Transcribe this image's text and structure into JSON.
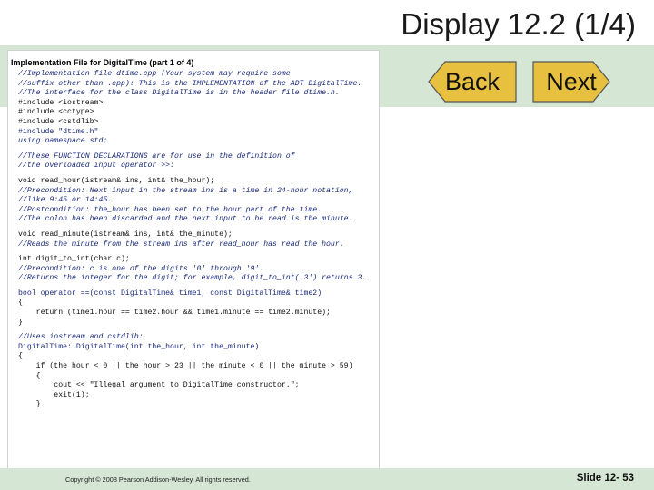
{
  "slide": {
    "title": "Display 12.2 (1/4)",
    "nav": {
      "back_label": "Back",
      "next_label": "Next"
    },
    "panel": {
      "header": "Implementation File for DigitalTime (part 1 of 4)",
      "lines": [
        {
          "text": "//Implementation file dtime.cpp (Your system may require some",
          "style": "comment"
        },
        {
          "text": "//suffix other than .cpp): This is the IMPLEMENTATION of the ADT DigitalTime.",
          "style": "comment"
        },
        {
          "text": "//The interface for the class DigitalTime is in the header file dtime.h.",
          "style": "comment"
        },
        {
          "text": "#include <iostream>",
          "style": "plain"
        },
        {
          "text": "#include <cctype>",
          "style": "plain"
        },
        {
          "text": "#include <cstdlib>",
          "style": "plain"
        },
        {
          "text": "#include \"dtime.h\"",
          "style": "kw"
        },
        {
          "text": "using namespace std;",
          "style": "comment"
        },
        {
          "text": "",
          "style": "gap"
        },
        {
          "text": "//These FUNCTION DECLARATIONS are for use in the definition of",
          "style": "comment"
        },
        {
          "text": "//the overloaded input operator >>:",
          "style": "comment"
        },
        {
          "text": "",
          "style": "gap"
        },
        {
          "text": "void read_hour(istream& ins, int& the_hour);",
          "style": "plain"
        },
        {
          "text": "//Precondition: Next input in the stream ins is a time in 24-hour notation,",
          "style": "comment"
        },
        {
          "text": "//like 9:45 or 14:45.",
          "style": "comment"
        },
        {
          "text": "//Postcondition: the_hour has been set to the hour part of the time.",
          "style": "comment"
        },
        {
          "text": "//The colon has been discarded and the next input to be read is the minute.",
          "style": "comment"
        },
        {
          "text": "",
          "style": "gap"
        },
        {
          "text": "void read_minute(istream& ins, int& the_minute);",
          "style": "plain"
        },
        {
          "text": "//Reads the minute from the stream ins after read_hour has read the hour.",
          "style": "comment"
        },
        {
          "text": "",
          "style": "gap"
        },
        {
          "text": "int digit_to_int(char c);",
          "style": "plain"
        },
        {
          "text": "//Precondition: c is one of the digits '0' through '9'.",
          "style": "comment"
        },
        {
          "text": "//Returns the integer for the digit; for example, digit_to_int('3') returns 3.",
          "style": "comment"
        },
        {
          "text": "",
          "style": "gap"
        },
        {
          "text": "bool operator ==(const DigitalTime& time1, const DigitalTime& time2)",
          "style": "kw"
        },
        {
          "text": "{",
          "style": "plain"
        },
        {
          "text": "    return (time1.hour == time2.hour && time1.minute == time2.minute);",
          "style": "plain"
        },
        {
          "text": "}",
          "style": "plain"
        },
        {
          "text": "",
          "style": "gap"
        },
        {
          "text": "//Uses iostream and cstdlib:",
          "style": "comment"
        },
        {
          "text": "DigitalTime::DigitalTime(int the_hour, int the_minute)",
          "style": "kw"
        },
        {
          "text": "{",
          "style": "plain"
        },
        {
          "text": "    if (the_hour < 0 || the_hour > 23 || the_minute < 0 || the_minute > 59)",
          "style": "plain"
        },
        {
          "text": "    {",
          "style": "plain"
        },
        {
          "text": "        cout << \"Illegal argument to DigitalTime constructor.\";",
          "style": "plain"
        },
        {
          "text": "        exit(1);",
          "style": "plain"
        },
        {
          "text": "    }",
          "style": "plain"
        }
      ]
    },
    "footer": {
      "copyright": "Copyright © 2008 Pearson Addison-Wesley. All rights reserved.",
      "slide_number": "Slide 12- 53"
    }
  }
}
